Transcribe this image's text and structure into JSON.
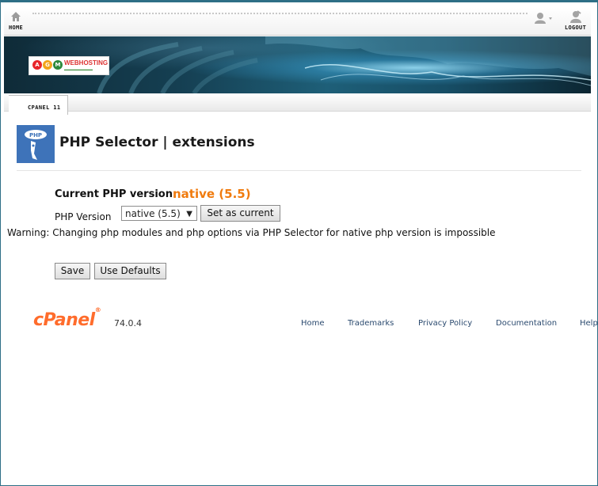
{
  "topnav": {
    "home_label": "HOME",
    "logout_label": "LOGOUT",
    "icons": [
      "home-icon",
      "user-icon",
      "logout-icon"
    ]
  },
  "banner": {
    "logo_word": "WEBHOSTING",
    "logo_letters": [
      "A",
      "G",
      "M"
    ],
    "logo_colors": [
      "#e8242a",
      "#f2a51b",
      "#2c8a3c"
    ]
  },
  "breadcrumb": {
    "label": "CPANEL 11"
  },
  "page": {
    "title": "PHP Selector | extensions",
    "icon": "php-icon"
  },
  "form": {
    "current_label": "Current PHP version:",
    "current_value": "native (5.5)",
    "version_label": "PHP Version",
    "version_selected": "native (5.5)",
    "set_current_button": "Set as current",
    "warning": "Warning: Changing php modules and php options via PHP Selector for native php version is impossible",
    "save_button": "Save",
    "defaults_button": "Use Defaults"
  },
  "footer": {
    "logo": "cPanel",
    "version": "74.0.4",
    "links": [
      "Home",
      "Trademarks",
      "Privacy Policy",
      "Documentation",
      "Help"
    ]
  },
  "colors": {
    "accent_orange": "#f07b0e",
    "cpanel_orange": "#ff6c2c",
    "link_blue": "#2b4a6f",
    "frame_blue": "#2e6f86"
  }
}
